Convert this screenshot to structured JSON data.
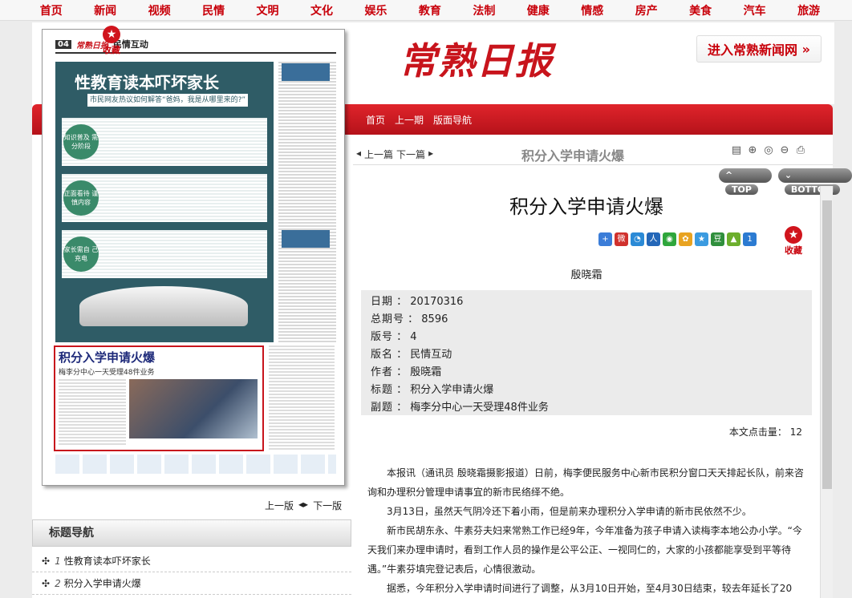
{
  "topnav": [
    "首页",
    "新闻",
    "视频",
    "民情",
    "文明",
    "文化",
    "娱乐",
    "教育",
    "法制",
    "健康",
    "情感",
    "房产",
    "美食",
    "汽车",
    "旅游"
  ],
  "logo": "常熟日报",
  "enter_site": "进入常熟新闻网",
  "sublinks": [
    "首页",
    "上一期",
    "版面导航"
  ],
  "paper": {
    "page_num": "04",
    "brand": "常熟日报",
    "section": "民情互动",
    "feature_title": "性教育读本吓坏家长",
    "feature_subtitle": "市民网友热议如何解答“爸妈，我是从哪里来的?”",
    "tags": [
      "知识普及\n需分阶段",
      "正面看待\n谨慎内容",
      "家长需自\n己充电"
    ],
    "article_title": "积分入学申请火爆",
    "article_subtitle": "梅李分中心一天受理48件业务"
  },
  "favorite_label": "收藏",
  "page_nav": {
    "prev": "上一版",
    "next": "下一版"
  },
  "menu": {
    "title": "标题导航",
    "items": [
      {
        "num": "1",
        "label": "性教育读本吓坏家长"
      },
      {
        "num": "2",
        "label": "积分入学申请火爆"
      }
    ]
  },
  "toolbar": {
    "prev": "上一篇",
    "next": "下一篇",
    "title": "积分入学申请火爆",
    "tools": [
      "notes-icon",
      "zoom-in-icon",
      "zoom-reset-icon",
      "zoom-out-icon",
      "print-icon"
    ]
  },
  "top_btn": "TOP",
  "bottom_btn": "BOTTOM",
  "article": {
    "title": "积分入学申请火爆",
    "author": "殷晓霜",
    "meta": [
      {
        "k": "日期",
        "v": "20170316"
      },
      {
        "k": "总期号",
        "v": "8596"
      },
      {
        "k": "版号",
        "v": "4"
      },
      {
        "k": "版名",
        "v": "民情互动"
      },
      {
        "k": "作者",
        "v": "殷晓霜"
      },
      {
        "k": "标题",
        "v": "积分入学申请火爆"
      },
      {
        "k": "副题",
        "v": "梅李分中心一天受理48件业务"
      }
    ],
    "hits_label": "本文点击量：",
    "hits": "12",
    "paragraphs": [
      "本报讯（通讯员 殷晓霜摄影报道）日前，梅李便民服务中心新市民积分窗口天天排起长队，前来咨询和办理积分管理申请事宜的新市民络绎不绝。",
      "3月13日，虽然天气阴冷还下着小雨，但是前来办理积分入学申请的新市民依然不少。",
      "新市民胡东永、牛素芬夫妇来常熟工作已经9年，今年准备为孩子申请入读梅李本地公办小学。“今天我们来办理申请时，看到工作人员的操作是公平公正、一视同仁的，大家的小孩都能享受到平等待遇。”牛素芬填完登记表后，心情很激动。",
      "据悉，今年积分入学申请时间进行了调整，从3月10日开始，至4月30日结束，较去年延长了20"
    ]
  },
  "colors": {
    "brand_red": "#c8000a",
    "band_red": "#d11a22",
    "feature_teal": "#2f5c66"
  }
}
